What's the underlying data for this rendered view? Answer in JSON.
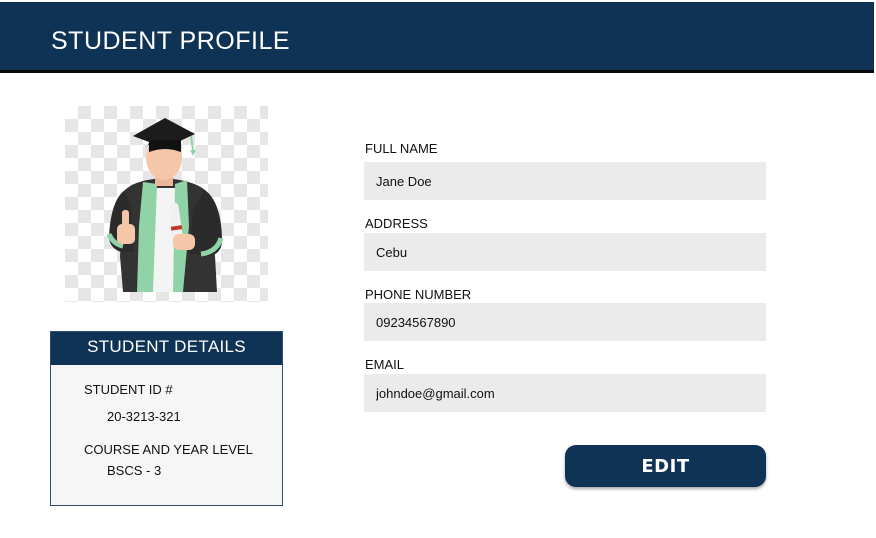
{
  "header": {
    "title": "STUDENT PROFILE"
  },
  "profile_photo": {
    "icon": "graduate-avatar-icon"
  },
  "details": {
    "heading": "STUDENT DETAILS",
    "student_id_label": "STUDENT ID #",
    "student_id_value": "20-3213-321",
    "course_label": "COURSE AND YEAR LEVEL",
    "course_value": "BSCS - 3"
  },
  "form": {
    "full_name": {
      "label": "FULL NAME",
      "value": "Jane Doe"
    },
    "address": {
      "label": "ADDRESS",
      "value": "Cebu"
    },
    "phone": {
      "label": "PHONE NUMBER",
      "value": "09234567890"
    },
    "email": {
      "label": "EMAIL",
      "value": "johndoe@gmail.com"
    }
  },
  "actions": {
    "edit_label": "EDIT"
  },
  "colors": {
    "primary": "#0f3355",
    "field_bg": "#ebebeb",
    "gown_accent": "#8fd3a6"
  }
}
